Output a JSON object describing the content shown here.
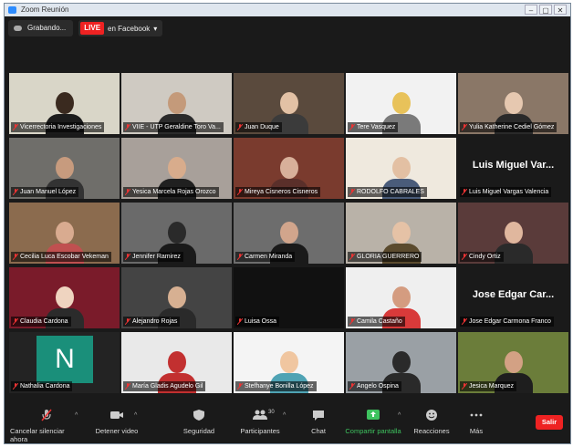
{
  "window": {
    "title": "Zoom Reunión",
    "controls": [
      "–",
      "▢",
      "✕"
    ]
  },
  "recording": {
    "label": "Grabando..."
  },
  "live": {
    "badge": "LIVE",
    "target": "en Facebook",
    "chevron": "▾"
  },
  "participants": [
    {
      "name": "Vicerrectoria Investigaciones",
      "active": true
    },
    {
      "name": "VIIE - UTP Geraldine Toro Va..."
    },
    {
      "name": "Juan Duque"
    },
    {
      "name": "Tere Vasquez"
    },
    {
      "name": "Yulia Katherine Cediel Gómez"
    },
    {
      "name": "Juan Manuel López"
    },
    {
      "name": "Yesica Marcela Rojas Orozco"
    },
    {
      "name": "Mireya Cisneros Cisneros"
    },
    {
      "name": "RODOLFO CABRALES"
    },
    {
      "name": "Luis Miguel Vargas Valencia",
      "display": "Luis Miguel Var..."
    },
    {
      "name": "Cecilia Luca Escobar Vekeman"
    },
    {
      "name": "Jennifer Ramirez"
    },
    {
      "name": "Carmen Miranda"
    },
    {
      "name": "GLORIA GUERRERO"
    },
    {
      "name": "Cindy Ortiz"
    },
    {
      "name": "Claudia Cardona"
    },
    {
      "name": "Alejandro Rojas"
    },
    {
      "name": "Luisa Ossa"
    },
    {
      "name": "Camila Castaño"
    },
    {
      "name": "Jose Edgar Carmona Franco",
      "display": "Jose Edgar Car..."
    },
    {
      "name": "Nathalia Cardona",
      "avatar": "N"
    },
    {
      "name": "María Gladis Agudelo Gil"
    },
    {
      "name": "Stefhanye Bonilla López"
    },
    {
      "name": "Angelo Ospina"
    },
    {
      "name": "Jesica Marquez"
    }
  ],
  "toolbar": {
    "mute": "Cancelar silenciar ahora",
    "video": "Detener video",
    "security": "Seguridad",
    "participants": "Participantes",
    "participants_count": "30",
    "chat": "Chat",
    "share": "Compartir pantalla",
    "reactions": "Reacciones",
    "more": "Más",
    "leave": "Salir",
    "chevron": "^"
  },
  "colors": {
    "active_speaker": "#c6e84a",
    "share_green": "#3ec35f",
    "leave_red": "#e22222",
    "avatar_teal": "#1a8f7a"
  }
}
